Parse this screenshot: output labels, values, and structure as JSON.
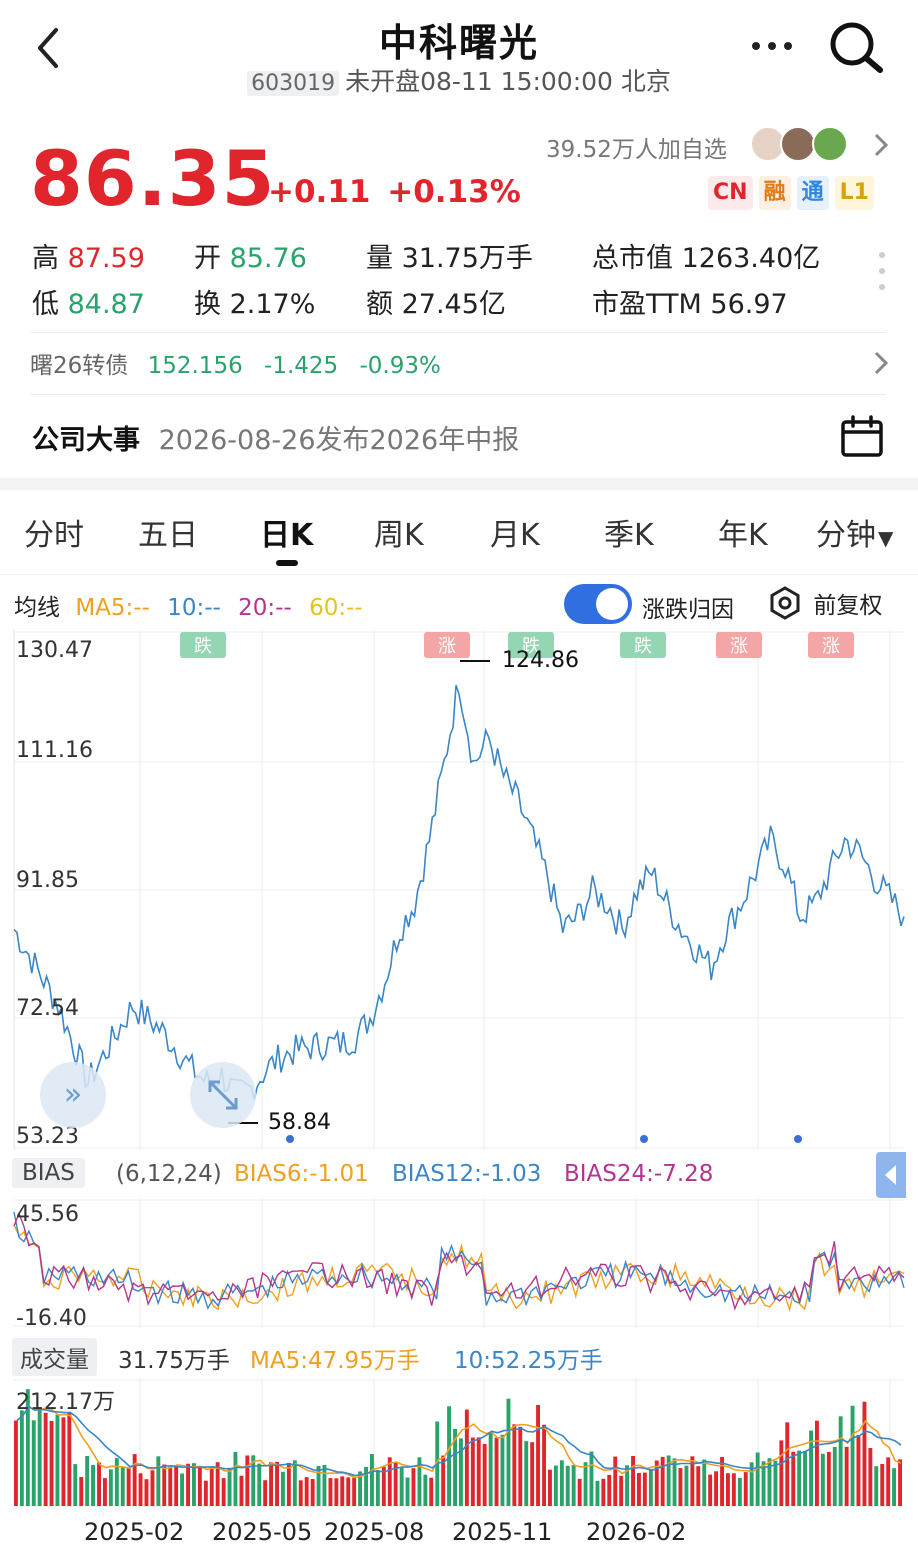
{
  "header": {
    "title": "中科曙光",
    "code": "603019",
    "status": "未开盘08-11 15:00:00 北京",
    "followers": "39.52万人加自选"
  },
  "quote": {
    "price": "86.35",
    "change": "+0.11",
    "change_pct": "+0.13%",
    "badges": [
      "CN",
      "融",
      "通",
      "L1"
    ]
  },
  "stats": {
    "high_label": "高",
    "high": "87.59",
    "low_label": "低",
    "low": "84.87",
    "open_label": "开",
    "open": "85.76",
    "turnover_label": "换",
    "turnover": "2.17%",
    "volume_label": "量",
    "volume": "31.75万手",
    "amount_label": "额",
    "amount": "27.45亿",
    "mktcap_label": "总市值",
    "mktcap": "1263.40亿",
    "pe_label": "市盈TTM",
    "pe": "56.97"
  },
  "bond": {
    "name": "曙26转债",
    "price": "152.156",
    "change": "-1.425",
    "change_pct": "-0.93%"
  },
  "event": {
    "label": "公司大事",
    "text": "2026-08-26发布2026年中报"
  },
  "tabs": [
    "分时",
    "五日",
    "日K",
    "周K",
    "月K",
    "季K",
    "年K",
    "分钟"
  ],
  "active_tab": "日K",
  "ma": {
    "label": "均线",
    "ma5": "MA5:--",
    "ma10": "10:--",
    "ma20": "20:--",
    "ma60": "60:--",
    "toggle_label": "涨跌归因",
    "adjust_label": "前复权"
  },
  "price_chart": {
    "y_labels": [
      "130.47",
      "111.16",
      "91.85",
      "72.54",
      "53.23"
    ],
    "high_marker": "124.86",
    "low_marker": "58.84",
    "event_tags": [
      {
        "text": "跌",
        "kind": "down"
      },
      {
        "text": "涨",
        "kind": "up"
      },
      {
        "text": "跌",
        "kind": "down"
      },
      {
        "text": "跌",
        "kind": "down"
      },
      {
        "text": "涨",
        "kind": "up"
      },
      {
        "text": "涨",
        "kind": "up"
      }
    ]
  },
  "bias": {
    "label": "BIAS",
    "params": "(6,12,24)",
    "bias6": "BIAS6:-1.01",
    "bias12": "BIAS12:-1.03",
    "bias24": "BIAS24:-7.28",
    "y_top": "45.56",
    "y_bottom": "-16.40"
  },
  "volume": {
    "label": "成交量",
    "current": "31.75万手",
    "ma5": "MA5:47.95万手",
    "ma10": "10:52.25万手",
    "y_top": "212.17万"
  },
  "x_axis": [
    "2025-02",
    "2025-05",
    "2025-08",
    "2025-11",
    "2026-02"
  ],
  "colors": {
    "up": "#e0262c",
    "down": "#2aa36b",
    "price_line": "#3a86c8",
    "ma5": "#f0a020",
    "ma10": "#3a86c8",
    "ma20": "#b4358f",
    "ma60": "#e6c21f"
  },
  "chart_data": {
    "type": "line",
    "series": [
      {
        "values": [
          86,
          82,
          78,
          74,
          68,
          62,
          66,
          70,
          74,
          72,
          70,
          67,
          64,
          62,
          63,
          60,
          61,
          64,
          66,
          67,
          67.5,
          68,
          68,
          69,
          72,
          78,
          86,
          90,
          100,
          112,
          125,
          112,
          116,
          110,
          106,
          100,
          94,
          86,
          88,
          92,
          90,
          86,
          92,
          95,
          90,
          86,
          83,
          80,
          86,
          90,
          95,
          100,
          96,
          88,
          90,
          95,
          100,
          98,
          94,
          91,
          88
        ]
      }
    ],
    "ylim": [
      53.23,
      130.47
    ],
    "annotations": [
      "124.86",
      "58.84"
    ]
  }
}
